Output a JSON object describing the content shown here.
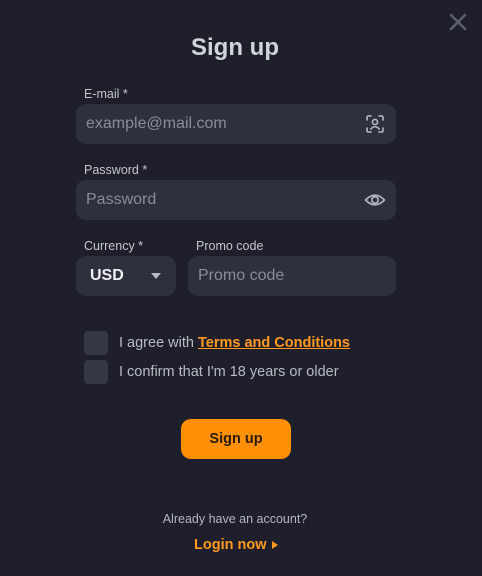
{
  "dialog": {
    "title": "Sign up",
    "close_icon": "close-icon"
  },
  "email": {
    "label": "E-mail *",
    "placeholder": "example@mail.com",
    "value": "",
    "icon": "face-scan-icon"
  },
  "password": {
    "label": "Password *",
    "placeholder": "Password",
    "value": "",
    "icon": "eye-icon"
  },
  "currency": {
    "label": "Currency *",
    "selected": "USD",
    "icon": "caret-down-icon"
  },
  "promo": {
    "label": "Promo code",
    "placeholder": "Promo code",
    "value": ""
  },
  "agreements": {
    "terms_prefix": "I agree with ",
    "terms_link": "Terms and Conditions",
    "age_confirm": "I confirm that I'm 18 years or older"
  },
  "actions": {
    "signup_label": "Sign up",
    "already_text": "Already have an account?",
    "login_label": "Login now"
  },
  "colors": {
    "background": "#1f1f2b",
    "field": "#2f303e",
    "accent": "#ff9008"
  }
}
